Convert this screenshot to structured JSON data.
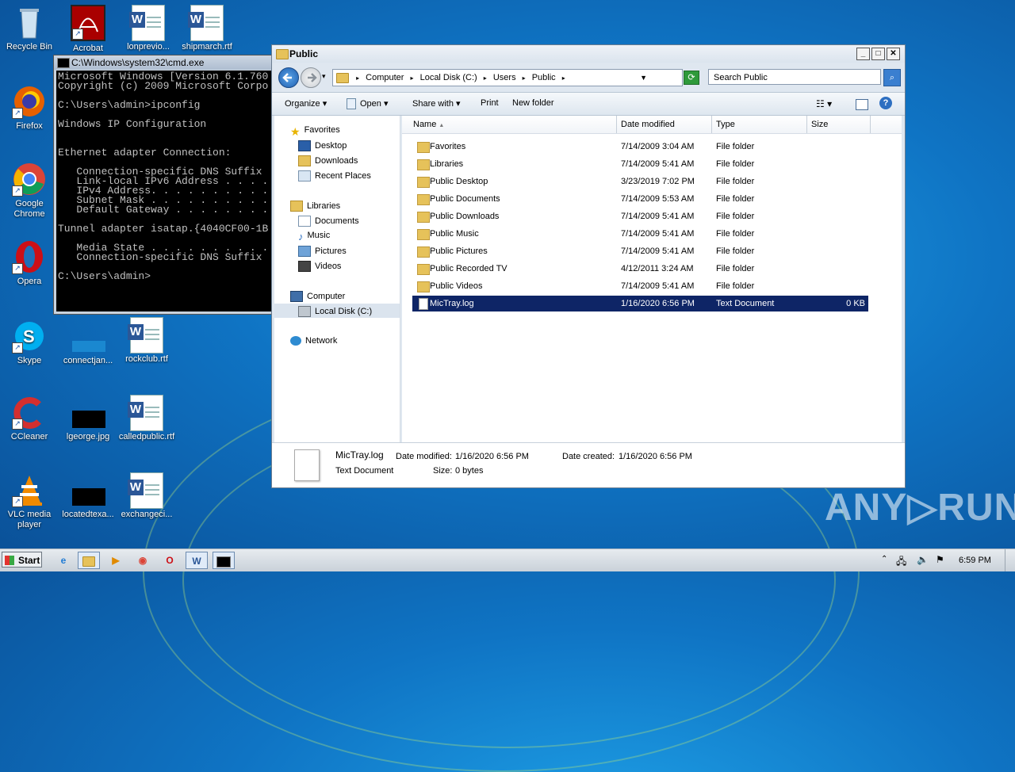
{
  "desktop_icons": [
    {
      "label": "Recycle Bin"
    },
    {
      "label": "Acrobat"
    },
    {
      "label": "lonprevio..."
    },
    {
      "label": "shipmarch.rtf"
    },
    {
      "label": "Firefox"
    },
    {
      "label": "Google Chrome"
    },
    {
      "label": "Opera"
    },
    {
      "label": "Skype"
    },
    {
      "label": "connectjan..."
    },
    {
      "label": "rockclub.rtf"
    },
    {
      "label": "CCleaner"
    },
    {
      "label": "lgeorge.jpg"
    },
    {
      "label": "calledpublic.rtf"
    },
    {
      "label": "VLC media player"
    },
    {
      "label": "locatedtexa..."
    },
    {
      "label": "exchangeci..."
    }
  ],
  "cmd": {
    "title": "C:\\Windows\\system32\\cmd.exe",
    "lines": "Microsoft Windows [Version 6.1.760\nCopyright (c) 2009 Microsoft Corpo\n\nC:\\Users\\admin>ipconfig\n\nWindows IP Configuration\n\n\nEthernet adapter Connection:\n\n   Connection-specific DNS Suffix\n   Link-local IPv6 Address . . . .\n   IPv4 Address. . . . . . . . . .\n   Subnet Mask . . . . . . . . . .\n   Default Gateway . . . . . . . .\n\nTunnel adapter isatap.{4040CF00-1B\n\n   Media State . . . . . . . . . .\n   Connection-specific DNS Suffix\n\nC:\\Users\\admin>"
  },
  "explorer": {
    "title": "Public",
    "breadcrumb": [
      "Computer",
      "Local Disk (C:)",
      "Users",
      "Public"
    ],
    "search_placeholder": "Search Public",
    "toolbar": {
      "organize": "Organize",
      "open": "Open",
      "share": "Share with",
      "print": "Print",
      "new_folder": "New folder"
    },
    "nav": {
      "favorites": "Favorites",
      "desktop": "Desktop",
      "downloads": "Downloads",
      "recent": "Recent Places",
      "libraries": "Libraries",
      "documents": "Documents",
      "music": "Music",
      "pictures": "Pictures",
      "videos": "Videos",
      "computer": "Computer",
      "local_disk": "Local Disk (C:)",
      "network": "Network"
    },
    "columns": {
      "name": "Name",
      "date": "Date modified",
      "type": "Type",
      "size": "Size"
    },
    "rows": [
      {
        "name": "Favorites",
        "date": "7/14/2009 3:04 AM",
        "type": "File folder",
        "size": ""
      },
      {
        "name": "Libraries",
        "date": "7/14/2009 5:41 AM",
        "type": "File folder",
        "size": ""
      },
      {
        "name": "Public Desktop",
        "date": "3/23/2019 7:02 PM",
        "type": "File folder",
        "size": ""
      },
      {
        "name": "Public Documents",
        "date": "7/14/2009 5:53 AM",
        "type": "File folder",
        "size": ""
      },
      {
        "name": "Public Downloads",
        "date": "7/14/2009 5:41 AM",
        "type": "File folder",
        "size": ""
      },
      {
        "name": "Public Music",
        "date": "7/14/2009 5:41 AM",
        "type": "File folder",
        "size": ""
      },
      {
        "name": "Public Pictures",
        "date": "7/14/2009 5:41 AM",
        "type": "File folder",
        "size": ""
      },
      {
        "name": "Public Recorded TV",
        "date": "4/12/2011 3:24 AM",
        "type": "File folder",
        "size": ""
      },
      {
        "name": "Public Videos",
        "date": "7/14/2009 5:41 AM",
        "type": "File folder",
        "size": ""
      },
      {
        "name": "MicTray.log",
        "date": "1/16/2020 6:56 PM",
        "type": "Text Document",
        "size": "0 KB"
      }
    ],
    "details": {
      "name": "MicTray.log",
      "type": "Text Document",
      "modified_label": "Date modified:",
      "modified": "1/16/2020 6:56 PM",
      "created_label": "Date created:",
      "created": "1/16/2020 6:56 PM",
      "size_label": "Size:",
      "size": "0 bytes"
    }
  },
  "taskbar": {
    "start": "Start",
    "clock": "6:59 PM"
  },
  "watermark": "ANY RUN"
}
